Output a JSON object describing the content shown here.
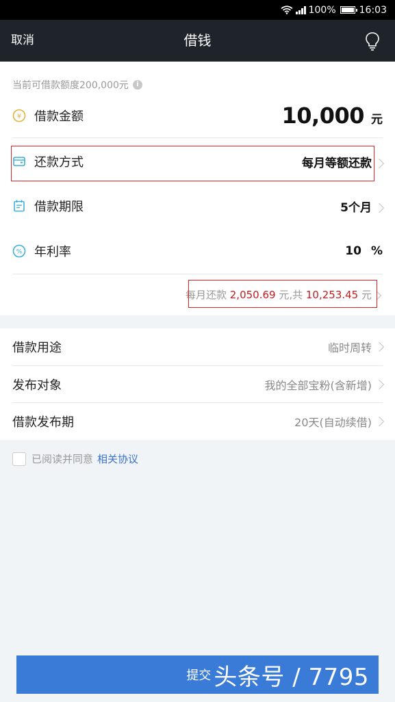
{
  "status_bar": {
    "battery_percent": "100%",
    "time": "16:03"
  },
  "header": {
    "cancel_label": "取消",
    "title": "借钱",
    "bulb_icon": "lightbulb-icon"
  },
  "quota_text": "当前可借款额度200,000元",
  "amount": {
    "label": "借款金额",
    "value": "10,000",
    "unit": "元",
    "icon": "yen-coin-icon"
  },
  "repay_method": {
    "label": "还款方式",
    "value": "每月等额还款",
    "icon": "wallet-card-icon"
  },
  "term": {
    "label": "借款期限",
    "value": "5个月",
    "icon": "calendar-icon"
  },
  "rate": {
    "label": "年利率",
    "value": "10",
    "unit": "%",
    "icon": "percent-icon"
  },
  "summary": {
    "prefix": "每月还款 ",
    "monthly": "2,050.69",
    "middle": " 元,共 ",
    "total": "10,253.45",
    "suffix": " 元"
  },
  "details": [
    {
      "label": "借款用途",
      "value": "临时周转"
    },
    {
      "label": "发布对象",
      "value": "我的全部宝粉(含新增)"
    },
    {
      "label": "借款发布期",
      "value": "20天(自动续借)"
    }
  ],
  "agreement": {
    "text": "已阅读并同意",
    "link": "相关协议"
  },
  "submit": {
    "label": "提交",
    "watermark": "头条号 / 7795"
  },
  "colors": {
    "accent": "#3b7bd8",
    "highlight_red": "#c21b1b",
    "header_bg": "#1f242b"
  }
}
